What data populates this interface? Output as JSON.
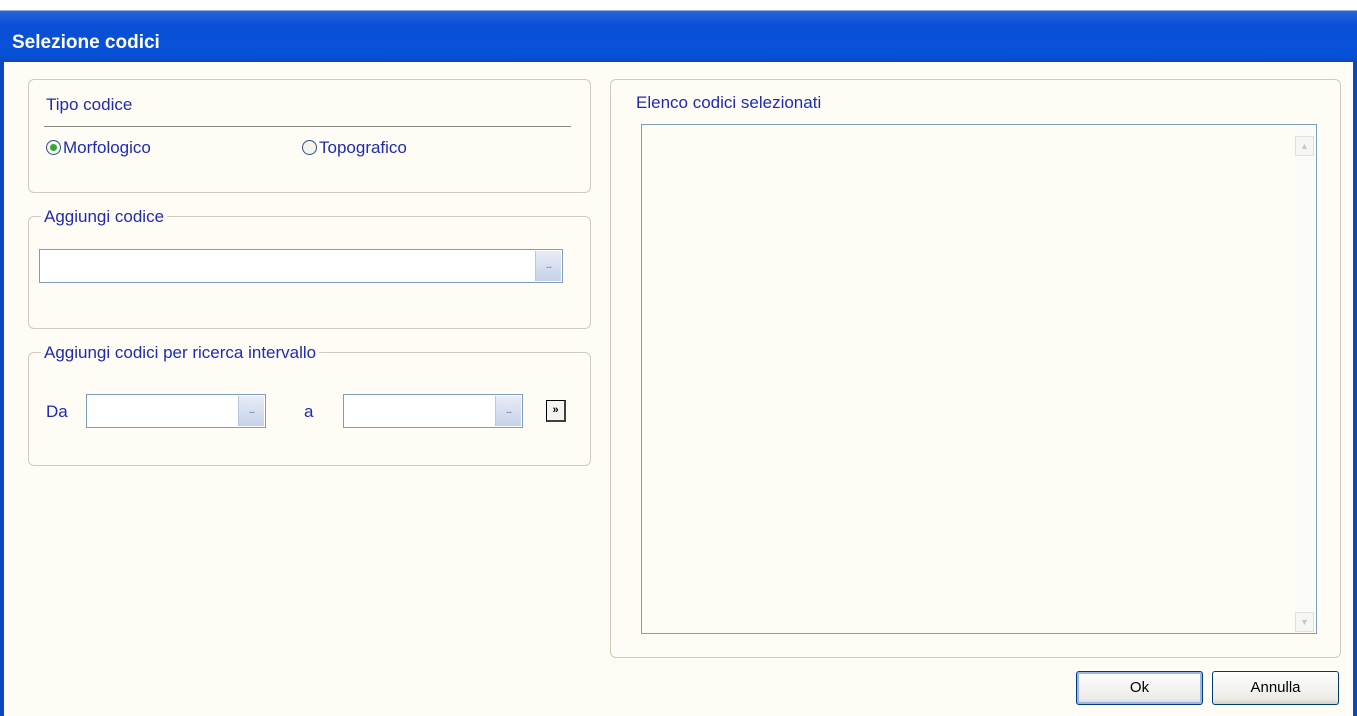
{
  "window": {
    "title": "Selezione codici"
  },
  "tipo_codice": {
    "legend": "Tipo codice",
    "options": [
      {
        "label": "Morfologico",
        "checked": true
      },
      {
        "label": "Topografico",
        "checked": false
      }
    ]
  },
  "aggiungi_codice": {
    "legend": "Aggiungi codice",
    "value": "",
    "browse_label": "..."
  },
  "intervallo": {
    "legend": "Aggiungi codici per ricerca intervallo",
    "from_label": "Da",
    "to_label": "a",
    "from_value": "",
    "to_value": "",
    "browse_label": "...",
    "add_label": "»"
  },
  "elenco": {
    "legend": "Elenco codici selezionati",
    "items": []
  },
  "buttons": {
    "ok": "Ok",
    "cancel": "Annulla"
  },
  "colors": {
    "title_bar": "#0a4fd6",
    "label_text": "#1f2bb0",
    "radio_dot": "#39a63b",
    "background": "#fefcf5"
  },
  "icons": {
    "scroll_up": "scroll-up-arrow-icon",
    "scroll_down": "scroll-down-arrow-icon"
  }
}
